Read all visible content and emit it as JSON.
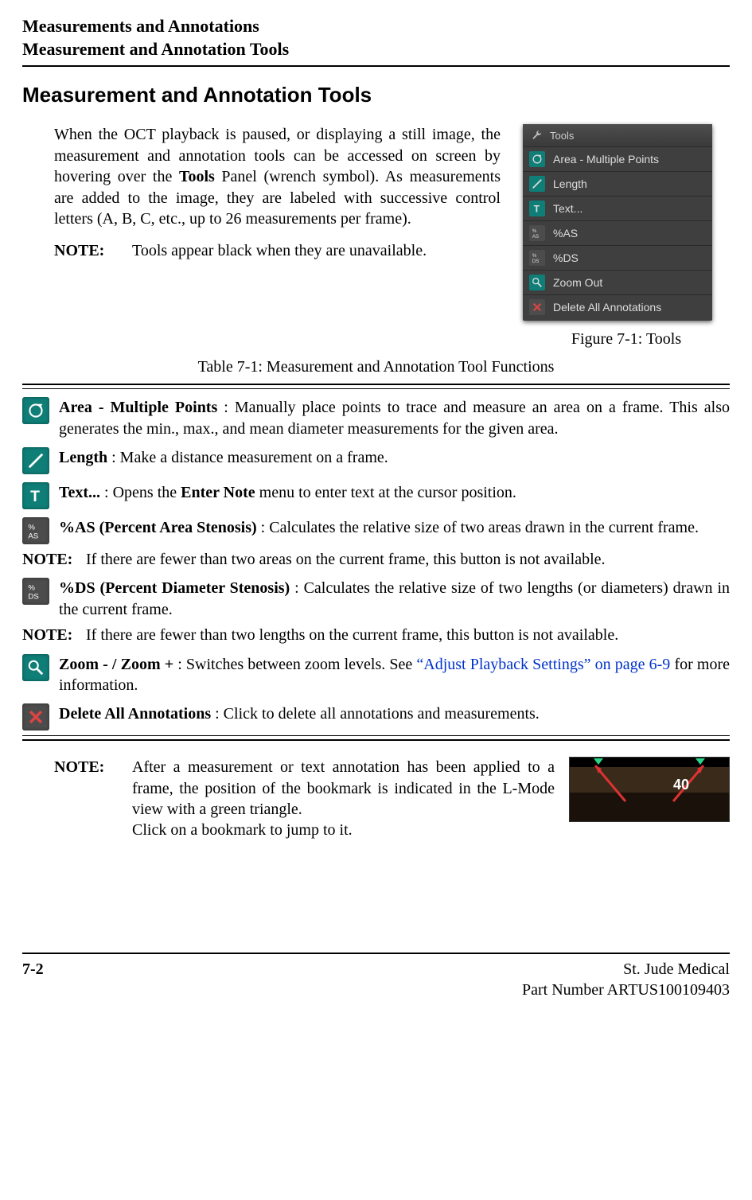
{
  "header": {
    "line1": "Measurements and Annotations",
    "line2": "Measurement and Annotation Tools"
  },
  "section_title": "Measurement and Annotation Tools",
  "intro_para": "When the OCT playback is paused, or displaying a still image, the measurement and annotation tools can be accessed on screen by hovering over the Tools Panel (wrench symbol). As measurements are added to the image, they are labeled with successive control letters (A, B, C, etc., up to 26 measurements per frame).",
  "intro_bold_word": "Tools",
  "intro_note_label": "NOTE:",
  "intro_note_text": "Tools appear black when they are unavailable.",
  "figure_caption": "Figure 7-1:  Tools",
  "table_caption": "Table 7-1:  Measurement and Annotation Tool Functions",
  "tools_panel": {
    "title": "Tools",
    "items": [
      {
        "icon": "area",
        "label": "Area - Multiple Points"
      },
      {
        "icon": "length",
        "label": "Length"
      },
      {
        "icon": "text",
        "label": "Text..."
      },
      {
        "icon": "as",
        "label": "%AS"
      },
      {
        "icon": "ds",
        "label": "%DS"
      },
      {
        "icon": "zoom",
        "label": "Zoom Out"
      },
      {
        "icon": "delete",
        "label": "Delete All Annotations"
      }
    ]
  },
  "tool_rows": [
    {
      "icon": "area",
      "title": "Area - Multiple Points",
      "sep": " : ",
      "desc": "Manually place points to trace and measure an area on a frame. This also generates the min., max., and mean diameter measurements for the given area."
    },
    {
      "icon": "length",
      "title": "Length",
      "sep": " : ",
      "desc": "Make a distance measurement on a frame."
    },
    {
      "icon": "text",
      "title": "Text...",
      "sep": " : ",
      "desc_pre": "Opens the ",
      "desc_bold": "Enter Note",
      "desc_post": " menu to enter text at the cursor position."
    },
    {
      "icon": "as",
      "title": "%AS (Percent Area Stenosis)",
      "sep": " : ",
      "desc": "Calculates the relative size of two areas drawn in the current frame.",
      "note_label": "NOTE:",
      "note": "If there are fewer than two areas on the current frame, this button is not available."
    },
    {
      "icon": "ds",
      "title": "%DS (Percent Diameter Stenosis)",
      "sep": " : ",
      "desc": "Calculates the relative size of two lengths (or diameters) drawn in the current frame.",
      "note_label": "NOTE:",
      "note": "If there are fewer than two lengths on the current frame, this button is not available."
    },
    {
      "icon": "zoom",
      "title": "Zoom - / Zoom +",
      "sep": " : ",
      "desc_pre": "Switches between zoom levels. See ",
      "xref": "“Adjust Playback Settings” on page 6-9",
      "desc_post": " for more information."
    },
    {
      "icon": "delete",
      "title": "Delete All Annotations",
      "sep": " : ",
      "desc": "Click to delete all annotations and measurements."
    }
  ],
  "final_note": {
    "label": "NOTE:",
    "text": "After a measurement or text annotation has been applied to a frame, the position of the bookmark is indicated in the L-Mode view with a green triangle.\nClick on a bookmark to jump to it."
  },
  "footer": {
    "page": "7-2",
    "company": "St. Jude Medical",
    "part": "Part Number ARTUS100109403"
  },
  "icon_colors": {
    "teal": "#0f7e77",
    "gray": "#4c4c4c"
  }
}
